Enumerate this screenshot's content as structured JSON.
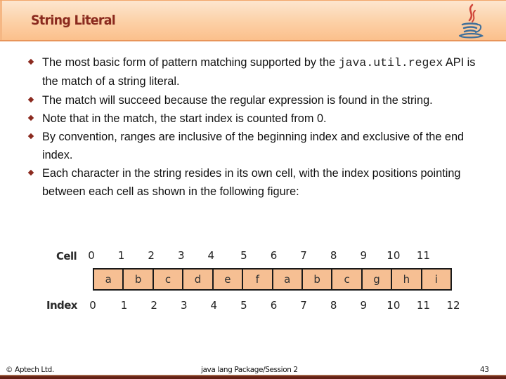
{
  "slide": {
    "title": "String Literal",
    "logo_icon": "java-coffee-cup-icon"
  },
  "bullets": [
    {
      "parts": [
        {
          "text": "The most basic form of pattern matching supported by the ",
          "style": "normal"
        },
        {
          "text": "java.util.regex",
          "style": "mono"
        },
        {
          "text": " API is the match of a string literal.",
          "style": "normal"
        }
      ]
    },
    {
      "parts": [
        {
          "text": "The match will succeed because the regular expression is found in the string.",
          "style": "normal"
        }
      ]
    },
    {
      "parts": [
        {
          "text": "Note that in the match, the start index is counted from 0.",
          "style": "normal"
        }
      ]
    },
    {
      "parts": [
        {
          "text": "By convention, ranges are inclusive of the beginning index and exclusive of the end index.",
          "style": "normal"
        }
      ]
    },
    {
      "parts": [
        {
          "text": "Each character in the string resides in its own cell, with the index positions pointing between each cell as shown in the following figure:",
          "style": "normal"
        }
      ]
    }
  ],
  "figure": {
    "cell_label": "Cell",
    "index_label": "Index",
    "cell_numbers": [
      "0",
      "1",
      "2",
      "3",
      "4",
      "5",
      "6",
      "7",
      "8",
      "9",
      "10",
      "11"
    ],
    "characters": [
      "a",
      "b",
      "c",
      "d",
      "e",
      "f",
      "a",
      "b",
      "c",
      "g",
      "h",
      "i"
    ],
    "index_numbers": [
      "0",
      "1",
      "2",
      "3",
      "4",
      "5",
      "6",
      "7",
      "8",
      "9",
      "10",
      "11",
      "12"
    ],
    "cell_fill_color": "#f6bf93"
  },
  "footer": {
    "copyright": "© Aptech Ltd.",
    "session": "java lang Package/Session 2",
    "page_number": "43"
  }
}
